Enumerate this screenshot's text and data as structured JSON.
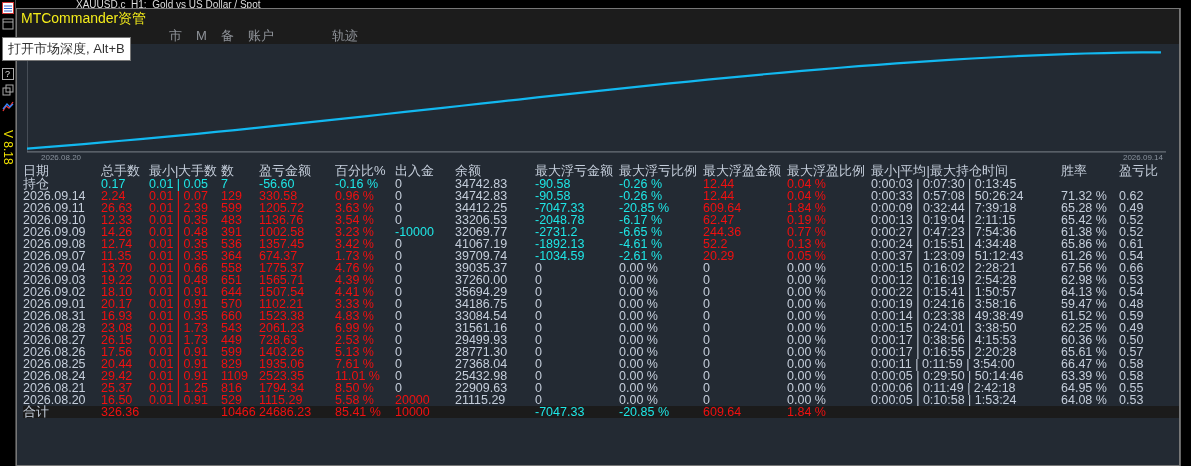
{
  "chart_header": {
    "text": "XAUUSD,c  H1:  Gold vs US Dollar / Spot"
  },
  "sidebar": {
    "question": "?",
    "version": "V 8.18"
  },
  "window": {
    "title": "MTCommander资管"
  },
  "tabs": [
    {
      "label": "市"
    },
    {
      "label": "M"
    },
    {
      "label": "备"
    },
    {
      "label": "账户"
    },
    {
      "label": "轨迹"
    }
  ],
  "tooltip": {
    "text": "打开市场深度, Alt+B"
  },
  "equity_chart": {
    "start_label": "2026.08.20",
    "end_label": "2026.09.14"
  },
  "table": {
    "columns": [
      "日期",
      "总手数",
      "最小|大手数",
      "数",
      "盈亏金额",
      "百分比%",
      "出入金",
      "余额",
      "最大浮亏金额",
      "最大浮亏比例",
      "最大浮盈金额",
      "最大浮盈比例",
      "最小|平均|最大持仓时间",
      "胜率",
      "盈亏比"
    ],
    "rows": [
      {
        "kind": "holding",
        "cells": [
          {
            "text": "持仓",
            "color": "#c5cedb"
          },
          {
            "text": "0.17",
            "color": "#1ee6e6"
          },
          {
            "text": "0.01 | 0.05",
            "color": "#1ee6e6"
          },
          {
            "text": "7",
            "color": "#1ee6e6"
          },
          {
            "text": "-56.60",
            "color": "#1ee6e6"
          },
          {
            "text": "-0.16 %",
            "color": "#1ee6e6"
          },
          {
            "text": "0",
            "color": "#c5cedb"
          },
          {
            "text": "34742.83",
            "color": "#c5cedb"
          },
          {
            "text": "-90.58",
            "color": "#1ee6e6"
          },
          {
            "text": "-0.26 %",
            "color": "#1ee6e6"
          },
          {
            "text": "12.44",
            "color": "#f01010"
          },
          {
            "text": "0.04 %",
            "color": "#f01010"
          },
          {
            "text": "0:00:03 | 0:07:30 | 0:13:45",
            "color": "#c5cedb"
          },
          null,
          null
        ]
      },
      {
        "kind": "day",
        "cells": [
          {
            "text": "2026.09.14",
            "color": "#c5cedb"
          },
          {
            "text": "2.24",
            "color": "#f01010"
          },
          {
            "text": "0.01 | 0.07",
            "color": "#f01010"
          },
          {
            "text": "129",
            "color": "#f01010"
          },
          {
            "text": "330.58",
            "color": "#f01010"
          },
          {
            "text": "0.96 %",
            "color": "#f01010"
          },
          {
            "text": "0",
            "color": "#c5cedb"
          },
          {
            "text": "34742.83",
            "color": "#c5cedb"
          },
          {
            "text": "-90.58",
            "color": "#1ee6e6"
          },
          {
            "text": "-0.26 %",
            "color": "#1ee6e6"
          },
          {
            "text": "12.44",
            "color": "#f01010"
          },
          {
            "text": "0.04 %",
            "color": "#f01010"
          },
          {
            "text": "0:00:33 | 0:57:08 | 50:26:24",
            "color": "#c5cedb"
          },
          {
            "text": "71.32 %",
            "color": "#c5cedb"
          },
          {
            "text": "0.62",
            "color": "#c5cedb"
          }
        ]
      },
      {
        "kind": "day",
        "cells": [
          {
            "text": "2026.09.11",
            "color": "#c5cedb"
          },
          {
            "text": "26.63",
            "color": "#f01010"
          },
          {
            "text": "0.01 | 2.39",
            "color": "#f01010"
          },
          {
            "text": "599",
            "color": "#f01010"
          },
          {
            "text": "1205.72",
            "color": "#f01010"
          },
          {
            "text": "3.63 %",
            "color": "#f01010"
          },
          {
            "text": "0",
            "color": "#c5cedb"
          },
          {
            "text": "34412.25",
            "color": "#c5cedb"
          },
          {
            "text": "-7047.33",
            "color": "#1ee6e6"
          },
          {
            "text": "-20.85 %",
            "color": "#1ee6e6"
          },
          {
            "text": "609.64",
            "color": "#f01010"
          },
          {
            "text": "1.84 %",
            "color": "#f01010"
          },
          {
            "text": "0:00:09 | 0:32:44 | 7:39:18",
            "color": "#c5cedb"
          },
          {
            "text": "65.28 %",
            "color": "#c5cedb"
          },
          {
            "text": "0.49",
            "color": "#c5cedb"
          }
        ]
      },
      {
        "kind": "day",
        "cells": [
          {
            "text": "2026.09.10",
            "color": "#c5cedb"
          },
          {
            "text": "12.33",
            "color": "#f01010"
          },
          {
            "text": "0.01 | 0.35",
            "color": "#f01010"
          },
          {
            "text": "483",
            "color": "#f01010"
          },
          {
            "text": "1136.76",
            "color": "#f01010"
          },
          {
            "text": "3.54 %",
            "color": "#f01010"
          },
          {
            "text": "0",
            "color": "#c5cedb"
          },
          {
            "text": "33206.53",
            "color": "#c5cedb"
          },
          {
            "text": "-2048.78",
            "color": "#1ee6e6"
          },
          {
            "text": "-6.17 %",
            "color": "#1ee6e6"
          },
          {
            "text": "62.47",
            "color": "#f01010"
          },
          {
            "text": "0.19 %",
            "color": "#f01010"
          },
          {
            "text": "0:00:13 | 0:19:04 | 2:11:15",
            "color": "#c5cedb"
          },
          {
            "text": "65.42 %",
            "color": "#c5cedb"
          },
          {
            "text": "0.52",
            "color": "#c5cedb"
          }
        ]
      },
      {
        "kind": "day",
        "cells": [
          {
            "text": "2026.09.09",
            "color": "#c5cedb"
          },
          {
            "text": "14.26",
            "color": "#f01010"
          },
          {
            "text": "0.01 | 0.48",
            "color": "#f01010"
          },
          {
            "text": "391",
            "color": "#f01010"
          },
          {
            "text": "1002.58",
            "color": "#f01010"
          },
          {
            "text": "3.23 %",
            "color": "#f01010"
          },
          {
            "text": "-10000",
            "color": "#1ee6e6"
          },
          {
            "text": "32069.77",
            "color": "#c5cedb"
          },
          {
            "text": "-2731.2",
            "color": "#1ee6e6"
          },
          {
            "text": "-6.65 %",
            "color": "#1ee6e6"
          },
          {
            "text": "244.36",
            "color": "#f01010"
          },
          {
            "text": "0.77 %",
            "color": "#f01010"
          },
          {
            "text": "0:00:27 | 0:47:23 | 7:54:36",
            "color": "#c5cedb"
          },
          {
            "text": "61.38 %",
            "color": "#c5cedb"
          },
          {
            "text": "0.52",
            "color": "#c5cedb"
          }
        ]
      },
      {
        "kind": "day",
        "cells": [
          {
            "text": "2026.09.08",
            "color": "#c5cedb"
          },
          {
            "text": "12.74",
            "color": "#f01010"
          },
          {
            "text": "0.01 | 0.35",
            "color": "#f01010"
          },
          {
            "text": "536",
            "color": "#f01010"
          },
          {
            "text": "1357.45",
            "color": "#f01010"
          },
          {
            "text": "3.42 %",
            "color": "#f01010"
          },
          {
            "text": "0",
            "color": "#c5cedb"
          },
          {
            "text": "41067.19",
            "color": "#c5cedb"
          },
          {
            "text": "-1892.13",
            "color": "#1ee6e6"
          },
          {
            "text": "-4.61 %",
            "color": "#1ee6e6"
          },
          {
            "text": "52.2",
            "color": "#f01010"
          },
          {
            "text": "0.13 %",
            "color": "#f01010"
          },
          {
            "text": "0:00:24 | 0:15:51 | 4:34:48",
            "color": "#c5cedb"
          },
          {
            "text": "65.86 %",
            "color": "#c5cedb"
          },
          {
            "text": "0.61",
            "color": "#c5cedb"
          }
        ]
      },
      {
        "kind": "day",
        "cells": [
          {
            "text": "2026.09.07",
            "color": "#c5cedb"
          },
          {
            "text": "11.35",
            "color": "#f01010"
          },
          {
            "text": "0.01 | 0.35",
            "color": "#f01010"
          },
          {
            "text": "364",
            "color": "#f01010"
          },
          {
            "text": "674.37",
            "color": "#f01010"
          },
          {
            "text": "1.73 %",
            "color": "#f01010"
          },
          {
            "text": "0",
            "color": "#c5cedb"
          },
          {
            "text": "39709.74",
            "color": "#c5cedb"
          },
          {
            "text": "-1034.59",
            "color": "#1ee6e6"
          },
          {
            "text": "-2.61 %",
            "color": "#1ee6e6"
          },
          {
            "text": "20.29",
            "color": "#f01010"
          },
          {
            "text": "0.05 %",
            "color": "#f01010"
          },
          {
            "text": "0:00:37 | 1:23:09 | 51:12:43",
            "color": "#c5cedb"
          },
          {
            "text": "61.26 %",
            "color": "#c5cedb"
          },
          {
            "text": "0.54",
            "color": "#c5cedb"
          }
        ]
      },
      {
        "kind": "day",
        "cells": [
          {
            "text": "2026.09.04",
            "color": "#c5cedb"
          },
          {
            "text": "13.70",
            "color": "#f01010"
          },
          {
            "text": "0.01 | 0.66",
            "color": "#f01010"
          },
          {
            "text": "558",
            "color": "#f01010"
          },
          {
            "text": "1775.37",
            "color": "#f01010"
          },
          {
            "text": "4.76 %",
            "color": "#f01010"
          },
          {
            "text": "0",
            "color": "#c5cedb"
          },
          {
            "text": "39035.37",
            "color": "#c5cedb"
          },
          {
            "text": "0",
            "color": "#c5cedb"
          },
          {
            "text": "0.00 %",
            "color": "#c5cedb"
          },
          {
            "text": "0",
            "color": "#c5cedb"
          },
          {
            "text": "0.00 %",
            "color": "#c5cedb"
          },
          {
            "text": "0:00:15 | 0:16:02 | 2:28:21",
            "color": "#c5cedb"
          },
          {
            "text": "67.56 %",
            "color": "#c5cedb"
          },
          {
            "text": "0.66",
            "color": "#c5cedb"
          }
        ]
      },
      {
        "kind": "day",
        "cells": [
          {
            "text": "2026.09.03",
            "color": "#c5cedb"
          },
          {
            "text": "19.22",
            "color": "#f01010"
          },
          {
            "text": "0.01 | 0.48",
            "color": "#f01010"
          },
          {
            "text": "651",
            "color": "#f01010"
          },
          {
            "text": "1565.71",
            "color": "#f01010"
          },
          {
            "text": "4.39 %",
            "color": "#f01010"
          },
          {
            "text": "0",
            "color": "#c5cedb"
          },
          {
            "text": "37260.00",
            "color": "#c5cedb"
          },
          {
            "text": "0",
            "color": "#c5cedb"
          },
          {
            "text": "0.00 %",
            "color": "#c5cedb"
          },
          {
            "text": "0",
            "color": "#c5cedb"
          },
          {
            "text": "0.00 %",
            "color": "#c5cedb"
          },
          {
            "text": "0:00:12 | 0:16:19 | 2:54:28",
            "color": "#c5cedb"
          },
          {
            "text": "62.98 %",
            "color": "#c5cedb"
          },
          {
            "text": "0.53",
            "color": "#c5cedb"
          }
        ]
      },
      {
        "kind": "day",
        "cells": [
          {
            "text": "2026.09.02",
            "color": "#c5cedb"
          },
          {
            "text": "18.10",
            "color": "#f01010"
          },
          {
            "text": "0.01 | 0.91",
            "color": "#f01010"
          },
          {
            "text": "644",
            "color": "#f01010"
          },
          {
            "text": "1507.54",
            "color": "#f01010"
          },
          {
            "text": "4.41 %",
            "color": "#f01010"
          },
          {
            "text": "0",
            "color": "#c5cedb"
          },
          {
            "text": "35694.29",
            "color": "#c5cedb"
          },
          {
            "text": "0",
            "color": "#c5cedb"
          },
          {
            "text": "0.00 %",
            "color": "#c5cedb"
          },
          {
            "text": "0",
            "color": "#c5cedb"
          },
          {
            "text": "0.00 %",
            "color": "#c5cedb"
          },
          {
            "text": "0:00:22 | 0:15:41 | 1:50:57",
            "color": "#c5cedb"
          },
          {
            "text": "64.13 %",
            "color": "#c5cedb"
          },
          {
            "text": "0.54",
            "color": "#c5cedb"
          }
        ]
      },
      {
        "kind": "day",
        "cells": [
          {
            "text": "2026.09.01",
            "color": "#c5cedb"
          },
          {
            "text": "20.17",
            "color": "#f01010"
          },
          {
            "text": "0.01 | 0.91",
            "color": "#f01010"
          },
          {
            "text": "570",
            "color": "#f01010"
          },
          {
            "text": "1102.21",
            "color": "#f01010"
          },
          {
            "text": "3.33 %",
            "color": "#f01010"
          },
          {
            "text": "0",
            "color": "#c5cedb"
          },
          {
            "text": "34186.75",
            "color": "#c5cedb"
          },
          {
            "text": "0",
            "color": "#c5cedb"
          },
          {
            "text": "0.00 %",
            "color": "#c5cedb"
          },
          {
            "text": "0",
            "color": "#c5cedb"
          },
          {
            "text": "0.00 %",
            "color": "#c5cedb"
          },
          {
            "text": "0:00:19 | 0:24:16 | 3:58:16",
            "color": "#c5cedb"
          },
          {
            "text": "59.47 %",
            "color": "#c5cedb"
          },
          {
            "text": "0.48",
            "color": "#c5cedb"
          }
        ]
      },
      {
        "kind": "day",
        "cells": [
          {
            "text": "2026.08.31",
            "color": "#c5cedb"
          },
          {
            "text": "16.93",
            "color": "#f01010"
          },
          {
            "text": "0.01 | 0.35",
            "color": "#f01010"
          },
          {
            "text": "660",
            "color": "#f01010"
          },
          {
            "text": "1523.38",
            "color": "#f01010"
          },
          {
            "text": "4.83 %",
            "color": "#f01010"
          },
          {
            "text": "0",
            "color": "#c5cedb"
          },
          {
            "text": "33084.54",
            "color": "#c5cedb"
          },
          {
            "text": "0",
            "color": "#c5cedb"
          },
          {
            "text": "0.00 %",
            "color": "#c5cedb"
          },
          {
            "text": "0",
            "color": "#c5cedb"
          },
          {
            "text": "0.00 %",
            "color": "#c5cedb"
          },
          {
            "text": "0:00:14 | 0:23:38 | 49:38:49",
            "color": "#c5cedb"
          },
          {
            "text": "61.52 %",
            "color": "#c5cedb"
          },
          {
            "text": "0.59",
            "color": "#c5cedb"
          }
        ]
      },
      {
        "kind": "day",
        "cells": [
          {
            "text": "2026.08.28",
            "color": "#c5cedb"
          },
          {
            "text": "23.08",
            "color": "#f01010"
          },
          {
            "text": "0.01 | 1.73",
            "color": "#f01010"
          },
          {
            "text": "543",
            "color": "#f01010"
          },
          {
            "text": "2061.23",
            "color": "#f01010"
          },
          {
            "text": "6.99 %",
            "color": "#f01010"
          },
          {
            "text": "0",
            "color": "#c5cedb"
          },
          {
            "text": "31561.16",
            "color": "#c5cedb"
          },
          {
            "text": "0",
            "color": "#c5cedb"
          },
          {
            "text": "0.00 %",
            "color": "#c5cedb"
          },
          {
            "text": "0",
            "color": "#c5cedb"
          },
          {
            "text": "0.00 %",
            "color": "#c5cedb"
          },
          {
            "text": "0:00:15 | 0:24:01 | 3:38:50",
            "color": "#c5cedb"
          },
          {
            "text": "62.25 %",
            "color": "#c5cedb"
          },
          {
            "text": "0.49",
            "color": "#c5cedb"
          }
        ]
      },
      {
        "kind": "day",
        "cells": [
          {
            "text": "2026.08.27",
            "color": "#c5cedb"
          },
          {
            "text": "26.15",
            "color": "#f01010"
          },
          {
            "text": "0.01 | 1.73",
            "color": "#f01010"
          },
          {
            "text": "449",
            "color": "#f01010"
          },
          {
            "text": "728.63",
            "color": "#f01010"
          },
          {
            "text": "2.53 %",
            "color": "#f01010"
          },
          {
            "text": "0",
            "color": "#c5cedb"
          },
          {
            "text": "29499.93",
            "color": "#c5cedb"
          },
          {
            "text": "0",
            "color": "#c5cedb"
          },
          {
            "text": "0.00 %",
            "color": "#c5cedb"
          },
          {
            "text": "0",
            "color": "#c5cedb"
          },
          {
            "text": "0.00 %",
            "color": "#c5cedb"
          },
          {
            "text": "0:00:17 | 0:38:56 | 4:15:53",
            "color": "#c5cedb"
          },
          {
            "text": "60.36 %",
            "color": "#c5cedb"
          },
          {
            "text": "0.50",
            "color": "#c5cedb"
          }
        ]
      },
      {
        "kind": "day",
        "cells": [
          {
            "text": "2026.08.26",
            "color": "#c5cedb"
          },
          {
            "text": "17.56",
            "color": "#f01010"
          },
          {
            "text": "0.01 | 0.91",
            "color": "#f01010"
          },
          {
            "text": "599",
            "color": "#f01010"
          },
          {
            "text": "1403.26",
            "color": "#f01010"
          },
          {
            "text": "5.13 %",
            "color": "#f01010"
          },
          {
            "text": "0",
            "color": "#c5cedb"
          },
          {
            "text": "28771.30",
            "color": "#c5cedb"
          },
          {
            "text": "0",
            "color": "#c5cedb"
          },
          {
            "text": "0.00 %",
            "color": "#c5cedb"
          },
          {
            "text": "0",
            "color": "#c5cedb"
          },
          {
            "text": "0.00 %",
            "color": "#c5cedb"
          },
          {
            "text": "0:00:17 | 0:16:55 | 2:20:28",
            "color": "#c5cedb"
          },
          {
            "text": "65.61 %",
            "color": "#c5cedb"
          },
          {
            "text": "0.57",
            "color": "#c5cedb"
          }
        ]
      },
      {
        "kind": "day",
        "cells": [
          {
            "text": "2026.08.25",
            "color": "#c5cedb"
          },
          {
            "text": "20.44",
            "color": "#f01010"
          },
          {
            "text": "0.01 | 0.91",
            "color": "#f01010"
          },
          {
            "text": "829",
            "color": "#f01010"
          },
          {
            "text": "1935.06",
            "color": "#f01010"
          },
          {
            "text": "7.61 %",
            "color": "#f01010"
          },
          {
            "text": "0",
            "color": "#c5cedb"
          },
          {
            "text": "27368.04",
            "color": "#c5cedb"
          },
          {
            "text": "0",
            "color": "#c5cedb"
          },
          {
            "text": "0.00 %",
            "color": "#c5cedb"
          },
          {
            "text": "0",
            "color": "#c5cedb"
          },
          {
            "text": "0.00 %",
            "color": "#c5cedb"
          },
          {
            "text": "0:00:11 | 0:11:59 | 3:54:00",
            "color": "#c5cedb"
          },
          {
            "text": "66.47 %",
            "color": "#c5cedb"
          },
          {
            "text": "0.58",
            "color": "#c5cedb"
          }
        ]
      },
      {
        "kind": "day",
        "cells": [
          {
            "text": "2026.08.24",
            "color": "#c5cedb"
          },
          {
            "text": "29.42",
            "color": "#f01010"
          },
          {
            "text": "0.01 | 0.91",
            "color": "#f01010"
          },
          {
            "text": "1109",
            "color": "#f01010"
          },
          {
            "text": "2523.35",
            "color": "#f01010"
          },
          {
            "text": "11.01 %",
            "color": "#f01010"
          },
          {
            "text": "0",
            "color": "#c5cedb"
          },
          {
            "text": "25432.98",
            "color": "#c5cedb"
          },
          {
            "text": "0",
            "color": "#c5cedb"
          },
          {
            "text": "0.00 %",
            "color": "#c5cedb"
          },
          {
            "text": "0",
            "color": "#c5cedb"
          },
          {
            "text": "0.00 %",
            "color": "#c5cedb"
          },
          {
            "text": "0:00:05 | 0:29:50 | 50:14:46",
            "color": "#c5cedb"
          },
          {
            "text": "63.39 %",
            "color": "#c5cedb"
          },
          {
            "text": "0.58",
            "color": "#c5cedb"
          }
        ]
      },
      {
        "kind": "day",
        "cells": [
          {
            "text": "2026.08.21",
            "color": "#c5cedb"
          },
          {
            "text": "25.37",
            "color": "#f01010"
          },
          {
            "text": "0.01 | 1.25",
            "color": "#f01010"
          },
          {
            "text": "816",
            "color": "#f01010"
          },
          {
            "text": "1794.34",
            "color": "#f01010"
          },
          {
            "text": "8.50 %",
            "color": "#f01010"
          },
          {
            "text": "0",
            "color": "#c5cedb"
          },
          {
            "text": "22909.63",
            "color": "#c5cedb"
          },
          {
            "text": "0",
            "color": "#c5cedb"
          },
          {
            "text": "0.00 %",
            "color": "#c5cedb"
          },
          {
            "text": "0",
            "color": "#c5cedb"
          },
          {
            "text": "0.00 %",
            "color": "#c5cedb"
          },
          {
            "text": "0:00:06 | 0:11:49 | 2:42:18",
            "color": "#c5cedb"
          },
          {
            "text": "64.95 %",
            "color": "#c5cedb"
          },
          {
            "text": "0.55",
            "color": "#c5cedb"
          }
        ]
      },
      {
        "kind": "day",
        "cells": [
          {
            "text": "2026.08.20",
            "color": "#c5cedb"
          },
          {
            "text": "16.50",
            "color": "#f01010"
          },
          {
            "text": "0.01 | 0.91",
            "color": "#f01010"
          },
          {
            "text": "529",
            "color": "#f01010"
          },
          {
            "text": "1115.29",
            "color": "#f01010"
          },
          {
            "text": "5.58 %",
            "color": "#f01010"
          },
          {
            "text": "20000",
            "color": "#f01010"
          },
          {
            "text": "21115.29",
            "color": "#c5cedb"
          },
          {
            "text": "0",
            "color": "#c5cedb"
          },
          {
            "text": "0.00 %",
            "color": "#c5cedb"
          },
          {
            "text": "0",
            "color": "#c5cedb"
          },
          {
            "text": "0.00 %",
            "color": "#c5cedb"
          },
          {
            "text": "0:00:05 | 0:10:58 | 1:53:24",
            "color": "#c5cedb"
          },
          {
            "text": "64.08 %",
            "color": "#c5cedb"
          },
          {
            "text": "0.53",
            "color": "#c5cedb"
          }
        ]
      },
      {
        "kind": "total",
        "cells": [
          {
            "text": "合计",
            "color": "#c5cedb"
          },
          {
            "text": "326.36",
            "color": "#f01010"
          },
          null,
          {
            "text": "10466",
            "color": "#f01010"
          },
          {
            "text": "24686.23",
            "color": "#f01010"
          },
          {
            "text": "85.41 %",
            "color": "#f01010"
          },
          {
            "text": "10000",
            "color": "#f01010"
          },
          null,
          {
            "text": "-7047.33",
            "color": "#1ee6e6"
          },
          {
            "text": "-20.85 %",
            "color": "#1ee6e6"
          },
          {
            "text": "609.64",
            "color": "#f01010"
          },
          {
            "text": "1.84 %",
            "color": "#f01010"
          },
          null,
          null,
          null
        ]
      }
    ]
  }
}
